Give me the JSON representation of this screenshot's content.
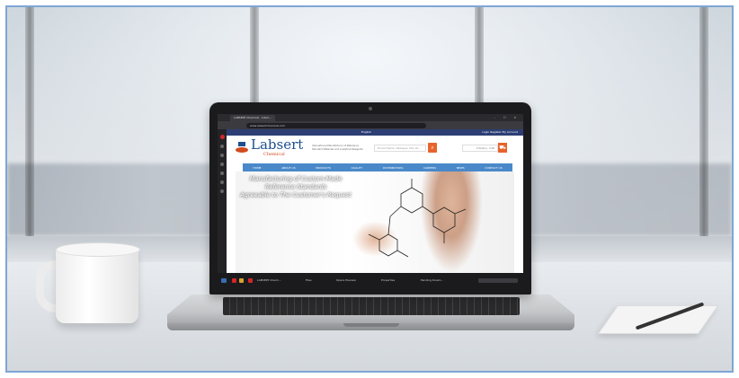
{
  "browser": {
    "tab_title": "LABSERT Chemical - Interl...",
    "url": "www.labsertchemical.com",
    "window_controls": "–  ☐  ✕"
  },
  "site": {
    "topbar_language": "English",
    "topbar_right": "Login   Register   My Account",
    "logo_name": "Labsert",
    "logo_sub": "Chemical",
    "tagline": "International Manufacturer of Reference Standard Materials and Analytical Reagents",
    "search_placeholder": "Product Name, Catalogue, CAS, etc.",
    "cart_label": "0 item(s) - 0.00",
    "nav": [
      "HOME",
      "ABOUT US",
      "PRODUCTS",
      "QUALITY",
      "DISTRIBUTORS",
      "CAREERS",
      "NEWS",
      "CONTACT US"
    ],
    "hero_text_1": "Manufacturing of Custom-Made Reference Standards",
    "hero_text_2": "Agreeable to The Customer's Request"
  },
  "taskbar": {
    "items": [
      "LABSERT Chemi...",
      "Files",
      "Opera Preview",
      "Properties",
      "Pending Downl..."
    ]
  },
  "colors": {
    "brand_blue": "#1e4f8f",
    "nav_blue": "#4a89c9",
    "accent_orange": "#e8632b",
    "topbar": "#2c3e74"
  }
}
